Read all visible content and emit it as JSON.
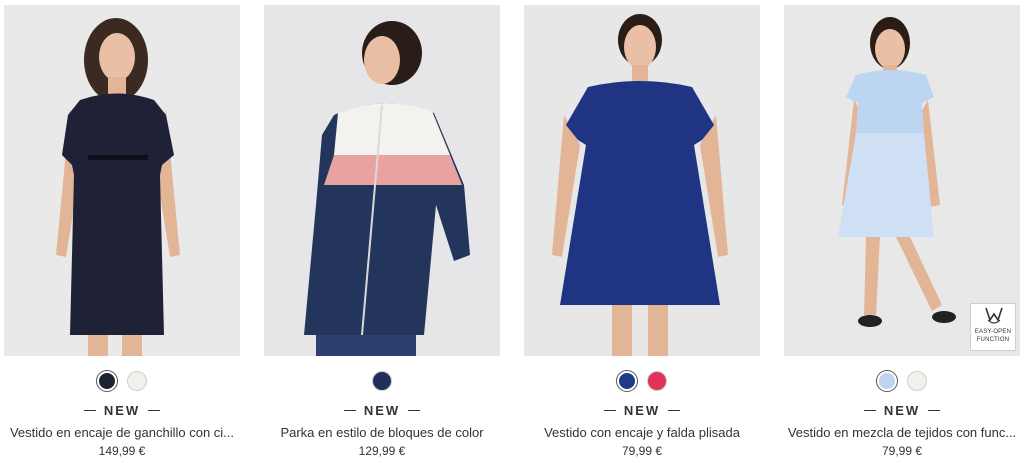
{
  "products": [
    {
      "name": "Vestido en encaje de ganchillo con ci...",
      "price": "149,99 €",
      "tag": "NEW",
      "swatches": [
        "#1d2235",
        "#f1f0eb"
      ],
      "selected_swatch": 0,
      "garment_color": "#1f2236"
    },
    {
      "name": "Parka en estilo de bloques de color",
      "price": "129,99 €",
      "tag": "NEW",
      "swatches": [
        "#1f2f5a"
      ],
      "selected_swatch": -1,
      "garment_color": "#23355a"
    },
    {
      "name": "Vestido con encaje y falda plisada",
      "price": "79,99 €",
      "tag": "NEW",
      "swatches": [
        "#1f3a8a",
        "#e0335a"
      ],
      "selected_swatch": 0,
      "garment_color": "#1f3584"
    },
    {
      "name": "Vestido en mezcla de tejidos con func...",
      "price": "79,99 €",
      "tag": "NEW",
      "swatches": [
        "#bcd4ef",
        "#f1f0eb"
      ],
      "selected_swatch": 0,
      "garment_color": "#bcd6f2",
      "badge": {
        "line1": "EASY-OPEN",
        "line2": "FUNCTION"
      }
    }
  ]
}
